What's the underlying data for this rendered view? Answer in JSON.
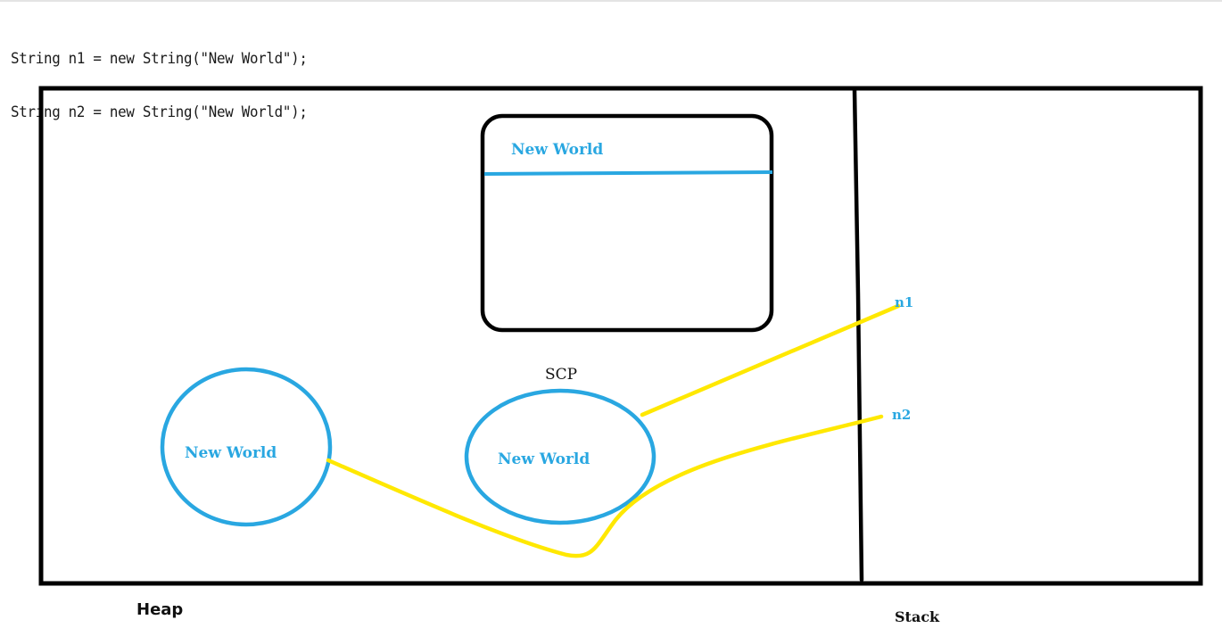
{
  "code": {
    "lines": [
      "String n1 = new String(\"New World\");",
      "String n2 = new String(\"New World\");"
    ]
  },
  "diagram": {
    "pool_box_label": "New World",
    "heap_object_label": "New World",
    "scp_object_label": "New World",
    "scp_label": "SCP",
    "n1_label": "n1",
    "n2_label": "n2",
    "heap_label": "Heap",
    "stack_label": "Stack"
  },
  "colors": {
    "outline": "#000000",
    "object": "#29a7e1",
    "reference": "#ffe800",
    "label_dark": "#111111"
  }
}
